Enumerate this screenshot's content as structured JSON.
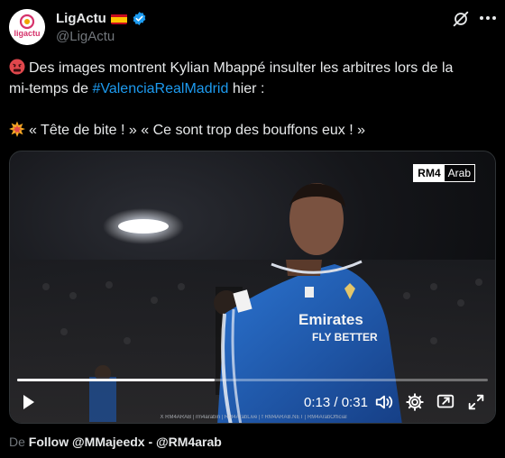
{
  "account": {
    "display_name": "LigActu",
    "handle": "@LigActu",
    "avatar_label": "ligactu",
    "verified": true
  },
  "tweet": {
    "line1_text": "Des images montrent Kylian Mbappé insulter les arbitres lors de la",
    "line2_prefix": "mi-temps de ",
    "hashtag": "#ValenciaRealMadrid",
    "line2_suffix": " hier :",
    "line3_text": "« Tête de bite ! » « Ce sont trop des bouffons eux ! »"
  },
  "media": {
    "watermark_a": "RM4",
    "watermark_b": "Arab",
    "jersey_text_1": "Emirates",
    "jersey_text_2": "FLY BETTER",
    "bottom_strip": "X RM4ARAB  |  rm4arabin  |  RM4ArabLive  |  f RM4ARAB.NET  |  RM4ArabOfficial",
    "progress": 0.42,
    "time_current": "0:13",
    "time_separator": " / ",
    "time_total": "0:31"
  },
  "footer": {
    "prefix": "De ",
    "source": "Follow @MMajeedx - @RM4arab"
  },
  "colors": {
    "accent": "#1d9bf0",
    "background": "#000000",
    "text": "#e7e9ea",
    "muted": "#71767b",
    "jersey": "#1f5fb4"
  },
  "icons": [
    "grok-icon",
    "more-icon",
    "play-icon",
    "volume-icon",
    "settings-icon",
    "pip-icon",
    "fullscreen-icon",
    "expand-icon"
  ]
}
